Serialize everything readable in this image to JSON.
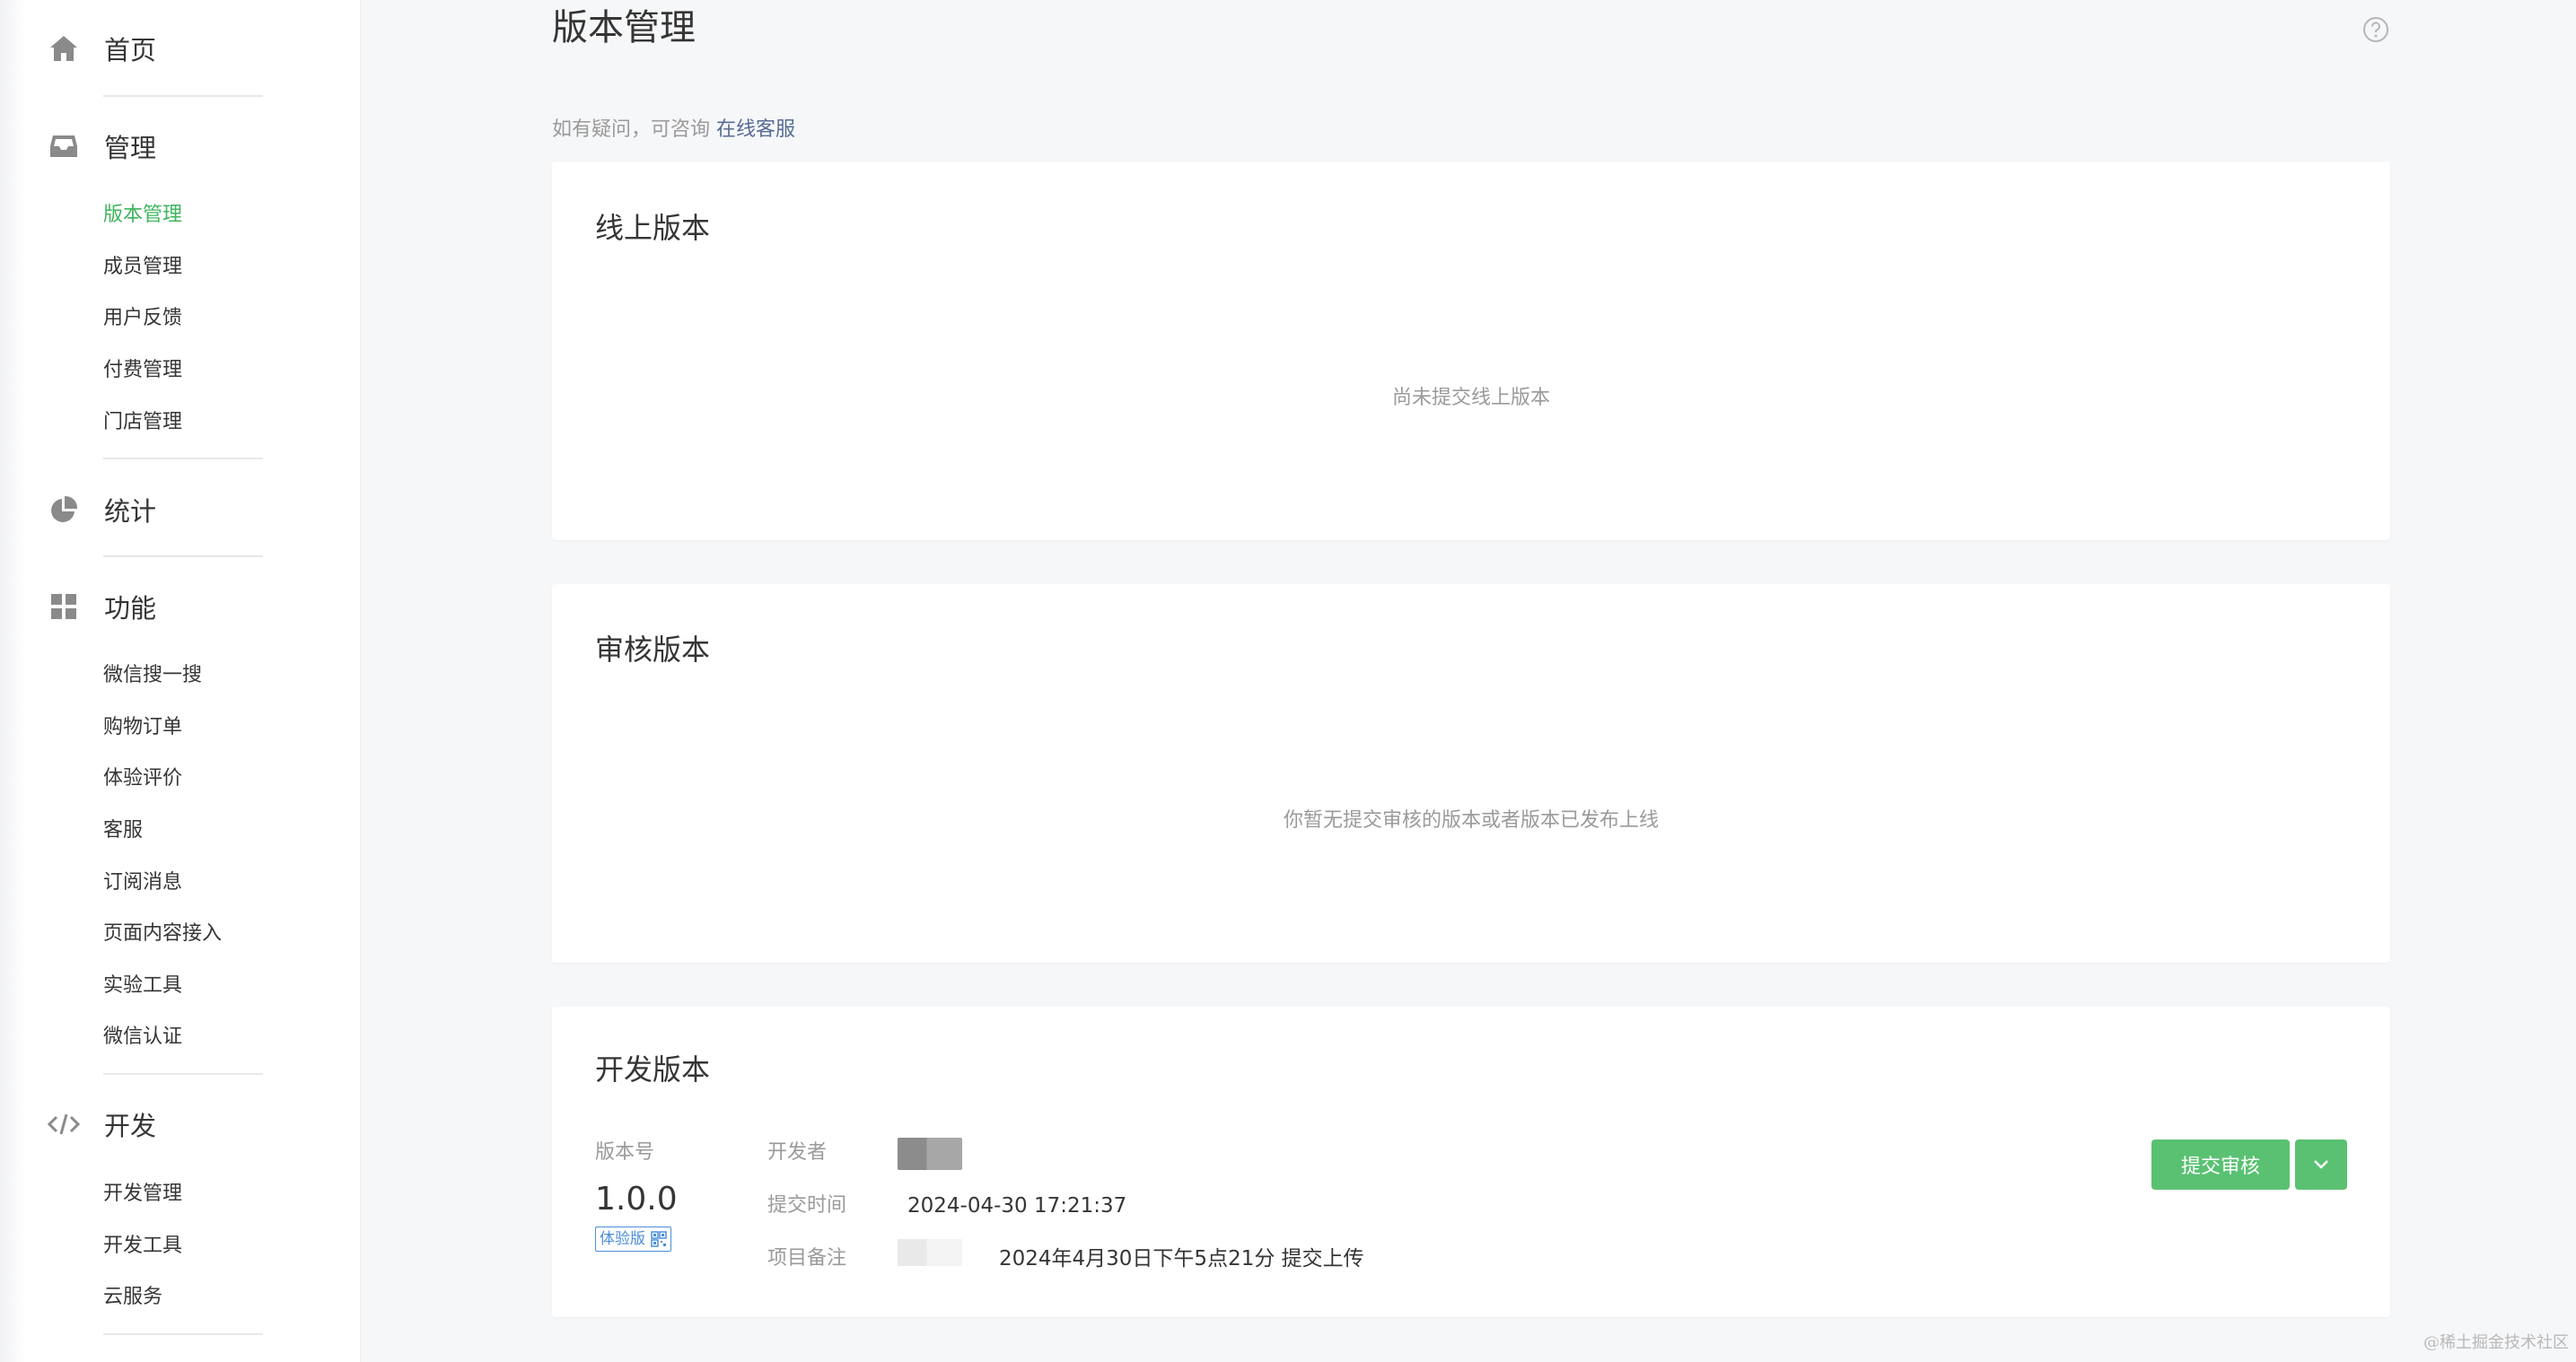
{
  "sidebar": {
    "home": {
      "label": "首页",
      "icon": "home-icon"
    },
    "manage": {
      "label": "管理",
      "icon": "inbox-icon",
      "items": [
        {
          "label": "版本管理",
          "active": true
        },
        {
          "label": "成员管理"
        },
        {
          "label": "用户反馈"
        },
        {
          "label": "付费管理"
        },
        {
          "label": "门店管理"
        }
      ]
    },
    "stats": {
      "label": "统计",
      "icon": "pie-chart-icon"
    },
    "features": {
      "label": "功能",
      "icon": "grid-icon",
      "items": [
        {
          "label": "微信搜一搜"
        },
        {
          "label": "购物订单"
        },
        {
          "label": "体验评价"
        },
        {
          "label": "客服"
        },
        {
          "label": "订阅消息"
        },
        {
          "label": "页面内容接入"
        },
        {
          "label": "实验工具"
        },
        {
          "label": "微信认证"
        }
      ]
    },
    "develop": {
      "label": "开发",
      "icon": "code-icon",
      "items": [
        {
          "label": "开发管理"
        },
        {
          "label": "开发工具"
        },
        {
          "label": "云服务"
        }
      ]
    }
  },
  "main": {
    "title": "版本管理",
    "notice_prefix": "如有疑问，可咨询",
    "notice_link": "在线客服",
    "online": {
      "title": "线上版本",
      "empty": "尚未提交线上版本"
    },
    "review": {
      "title": "审核版本",
      "empty": "你暂无提交审核的版本或者版本已发布上线"
    },
    "dev": {
      "title": "开发版本",
      "version_label": "版本号",
      "version": "1.0.0",
      "tag": "体验版",
      "developer_label": "开发者",
      "submit_time_label": "提交时间",
      "submit_time": "2024-04-30 17:21:37",
      "note_label": "项目备注",
      "note": "2024年4月30日下午5点21分 提交上传",
      "submit_button": "提交审核"
    }
  },
  "watermark": "@稀土掘金技术社区",
  "colors": {
    "accent_green": "#3fb45e",
    "button_green": "#5ac172",
    "link": "#576b95",
    "tag_blue": "#4b8ed8"
  }
}
